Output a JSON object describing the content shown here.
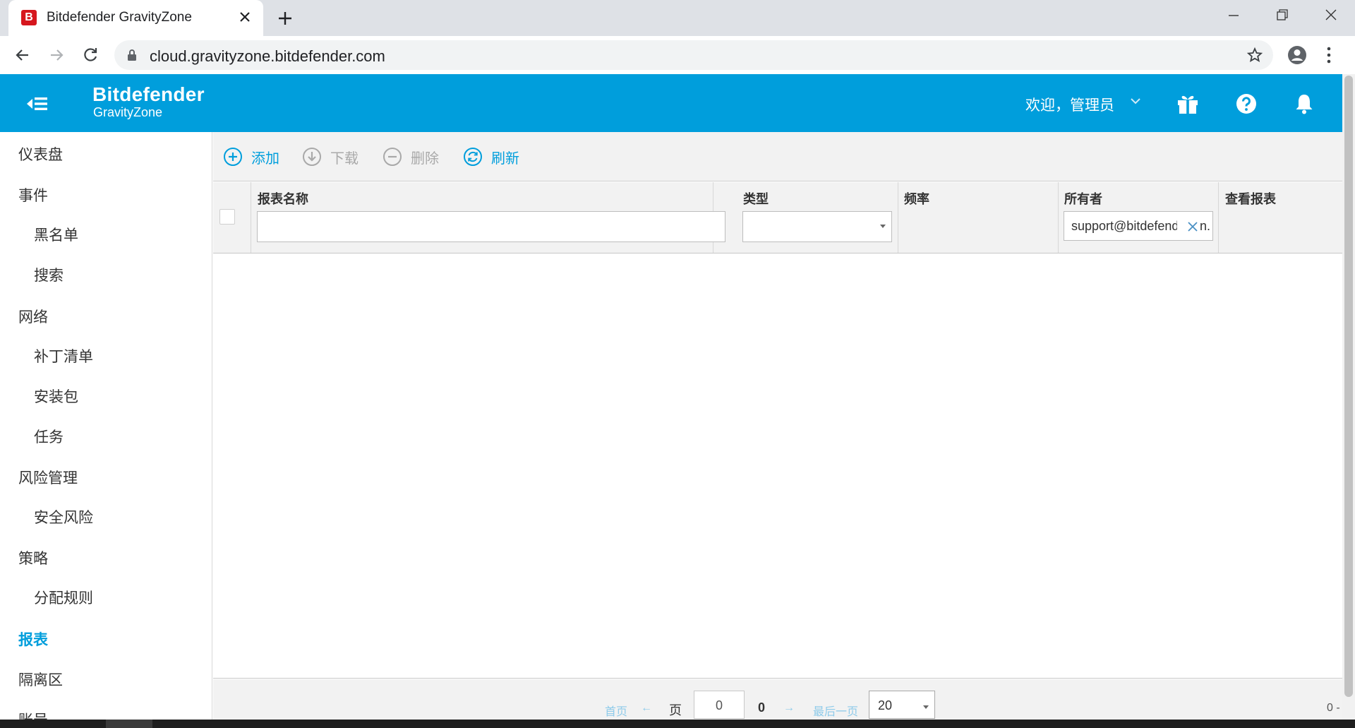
{
  "browser": {
    "tab_title": "Bitdefender GravityZone",
    "favicon_letter": "B",
    "url": "cloud.gravityzone.bitdefender.com"
  },
  "header": {
    "brand_main": "Bitdefender",
    "brand_sub": "GravityZone",
    "welcome": "欢迎，管理员",
    "brand_color": "#009edc"
  },
  "sidebar": {
    "items": [
      {
        "label": "仪表盘"
      },
      {
        "label": "事件"
      },
      {
        "label": "黑名单"
      },
      {
        "label": "搜索"
      },
      {
        "label": "网络"
      },
      {
        "label": "补丁清单"
      },
      {
        "label": "安装包"
      },
      {
        "label": "任务"
      },
      {
        "label": "风险管理"
      },
      {
        "label": "安全风险"
      },
      {
        "label": "策略"
      },
      {
        "label": "分配规则"
      },
      {
        "label": "报表"
      },
      {
        "label": "隔离区"
      },
      {
        "label": "账号"
      }
    ],
    "active": "报表"
  },
  "actions": {
    "add": "添加",
    "download": "下载",
    "delete": "删除",
    "refresh": "刷新"
  },
  "grid": {
    "columns": {
      "name": "报表名称",
      "type": "类型",
      "frequency": "频率",
      "owner": "所有者",
      "view": "查看报表"
    },
    "filters": {
      "name": "",
      "type": "",
      "owner": "support@bitdefender.com",
      "owner_tail": "n."
    }
  },
  "pager": {
    "first": "首页",
    "prev_arrow": "←",
    "page_label": "页",
    "page_value": "0",
    "page_total": "0",
    "next_arrow": "→",
    "last": "最后一页",
    "page_size": "20",
    "right_info": "0 -"
  }
}
